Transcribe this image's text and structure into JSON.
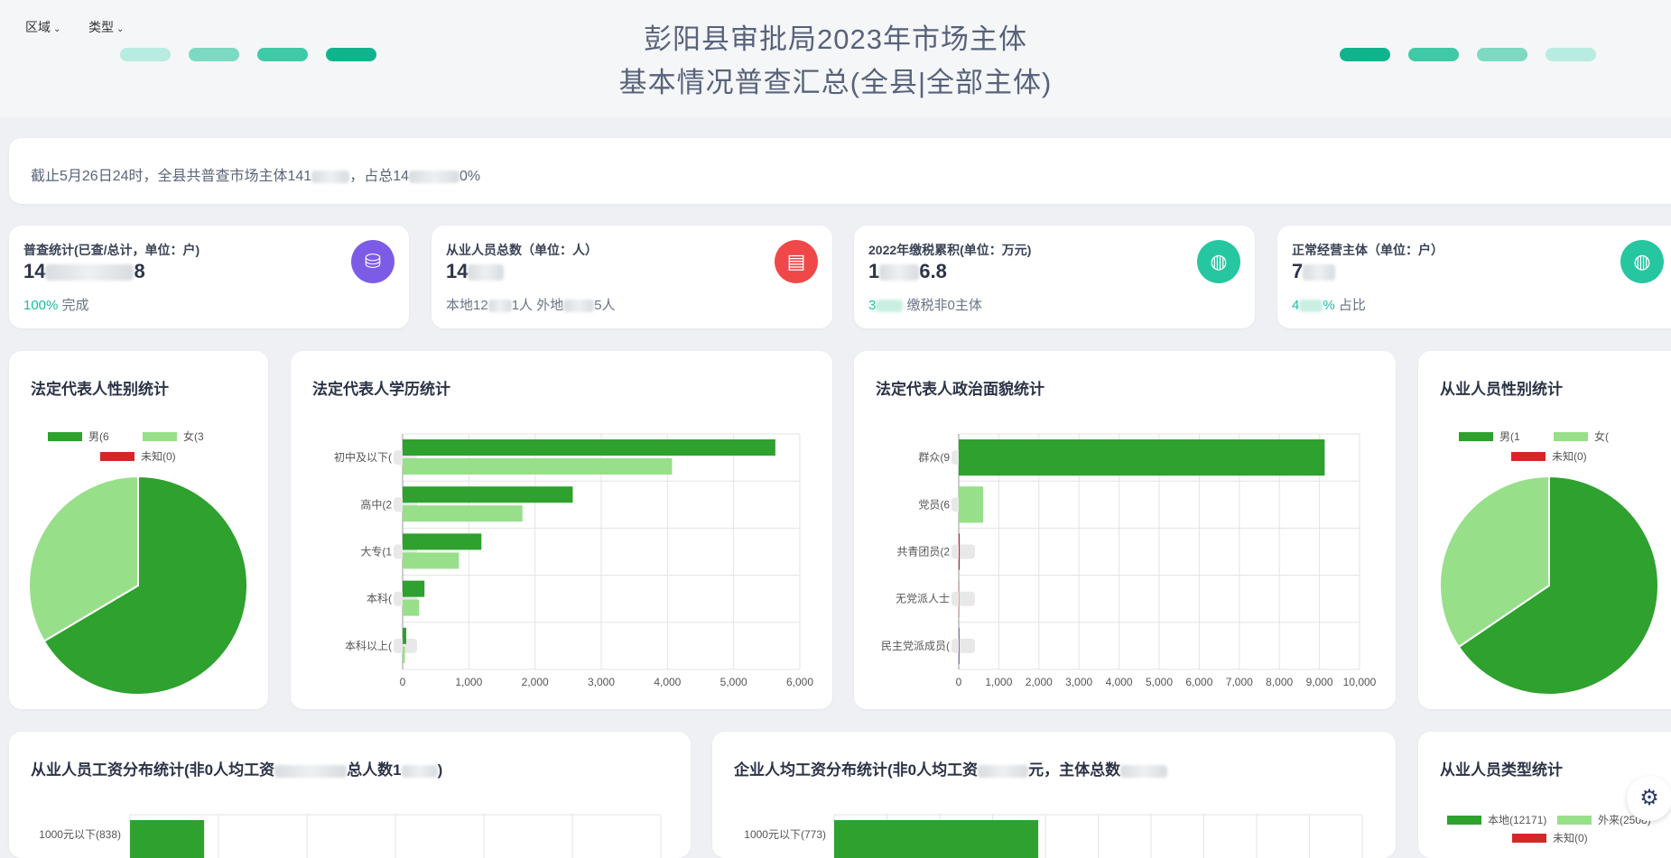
{
  "header": {
    "filters": [
      {
        "label": "区域"
      },
      {
        "label": "类型"
      }
    ],
    "title_line1": "彭阳县审批局2023年市场主体",
    "title_line2": "基本情况普查汇总(全县|全部主体)",
    "colors": {
      "dark": "#10b48c",
      "mid": "#40c9a6",
      "light": "#7dd9c1",
      "pale": "#b9ece0"
    }
  },
  "notice": {
    "text_a": "截止5月26日24时，全县共普查市场主体141",
    "text_b": "，占总14",
    "text_c": "0%"
  },
  "stats": [
    {
      "label": "普查统计(已查/总计，单位：户)",
      "value_a": "14",
      "value_b": "8",
      "sub_hl": "100%",
      "sub_text": " 完成",
      "icon": "database-icon",
      "color": "#7c5ce6"
    },
    {
      "label": "从业人员总数（单位：人）",
      "value_a": "14",
      "value_b": "",
      "sub_text": "本地12",
      "sub_text2": "1人 外地",
      "sub_text3": "5人",
      "icon": "badge-icon",
      "color": "#f04848"
    },
    {
      "label": "2022年缴税累积(单位：万元)",
      "value_a": "1",
      "value_b": "6.8",
      "sub_hl": "3",
      "sub_text": " 缴税非0主体",
      "icon": "globe-icon",
      "color": "#26c6a0"
    },
    {
      "label": "正常经营主体（单位：户）",
      "value_a": "7",
      "value_b": "",
      "sub_hl": "4",
      "sub_hl2": "%",
      "sub_text": " 占比",
      "icon": "globe-icon",
      "color": "#26c6a0"
    }
  ],
  "charts": {
    "gender_legal": {
      "title": "法定代表人性别统计"
    },
    "education": {
      "title": "法定代表人学历统计"
    },
    "political": {
      "title": "法定代表人政治面貌统计"
    },
    "gender_staff": {
      "title": "从业人员性别统计"
    },
    "wage_staff": {
      "title_a": "从业人员工资分布统计(非0人均工资",
      "title_b": "总人数1"
    },
    "wage_company": {
      "title_a": "企业人均工资分布统计(非0人均工资",
      "title_b": "元，主体总数"
    },
    "staff_type": {
      "title": "从业人员类型统计"
    }
  },
  "chart_data": [
    {
      "type": "pie",
      "title": "法定代表人性别统计",
      "legend": "top",
      "slices": [
        {
          "name": "男(6",
          "value": 66.5,
          "color": "#2ea12e"
        },
        {
          "name": "女(3",
          "value": 33.5,
          "color": "#98df8a"
        },
        {
          "name": "未知(0)",
          "value": 0,
          "color": "#d62728"
        }
      ]
    },
    {
      "type": "bar",
      "orientation": "horizontal",
      "title": "法定代表人学历统计",
      "categories": [
        "初中及以下(",
        "高中(2",
        "大专(1",
        "本科(",
        "本科以上("
      ],
      "series": [
        {
          "values": [
            5630,
            2570,
            1190,
            330,
            55
          ],
          "color": "#2ea12e"
        },
        {
          "values": [
            4070,
            1810,
            850,
            250,
            35
          ],
          "color": "#98df8a"
        }
      ],
      "xlim": [
        0,
        6000
      ],
      "xticks": [
        "0",
        "1,000",
        "2,000",
        "3,000",
        "4,000",
        "5,000",
        "6,000"
      ]
    },
    {
      "type": "bar",
      "orientation": "horizontal",
      "title": "法定代表人政治面貌统计",
      "categories": [
        "群众(9",
        "党员(6",
        "共青团员(2",
        "无党派人士",
        "民主党派成员("
      ],
      "values": [
        9130,
        610,
        25,
        5,
        5
      ],
      "colors": [
        "#2ea12e",
        "#98df8a",
        "#d62728",
        "#ff9896",
        "#9467bd"
      ],
      "xlim": [
        0,
        10000
      ],
      "xticks": [
        "0",
        "1,000",
        "2,000",
        "3,000",
        "4,000",
        "5,000",
        "6,000",
        "7,000",
        "8,000",
        "9,000",
        "10,000"
      ]
    },
    {
      "type": "pie",
      "title": "从业人员性别统计",
      "legend": "top",
      "slices": [
        {
          "name": "男(1",
          "value": 65.5,
          "color": "#2ea12e"
        },
        {
          "name": "女(",
          "value": 34.5,
          "color": "#98df8a"
        },
        {
          "name": "未知(0)",
          "value": 0,
          "color": "#d62728"
        }
      ]
    },
    {
      "type": "bar",
      "orientation": "horizontal",
      "title": "从业人员工资分布统计",
      "categories": [
        "1000元以下(838)"
      ],
      "values": [
        838
      ],
      "xlim": [
        0,
        6000
      ]
    },
    {
      "type": "bar",
      "orientation": "horizontal",
      "title": "企业人均工资分布统计",
      "categories": [
        "1000元以下(773)"
      ],
      "values": [
        773
      ],
      "xlim": [
        0,
        2000
      ]
    },
    {
      "type": "pie",
      "title": "从业人员类型统计",
      "legend": "top",
      "slices": [
        {
          "name": "本地(12171)",
          "value": 12171,
          "color": "#2ea12e"
        },
        {
          "name": "外来(2508)",
          "value": 2508,
          "color": "#98df8a"
        },
        {
          "name": "未知(0)",
          "value": 0,
          "color": "#d62728"
        }
      ]
    }
  ]
}
